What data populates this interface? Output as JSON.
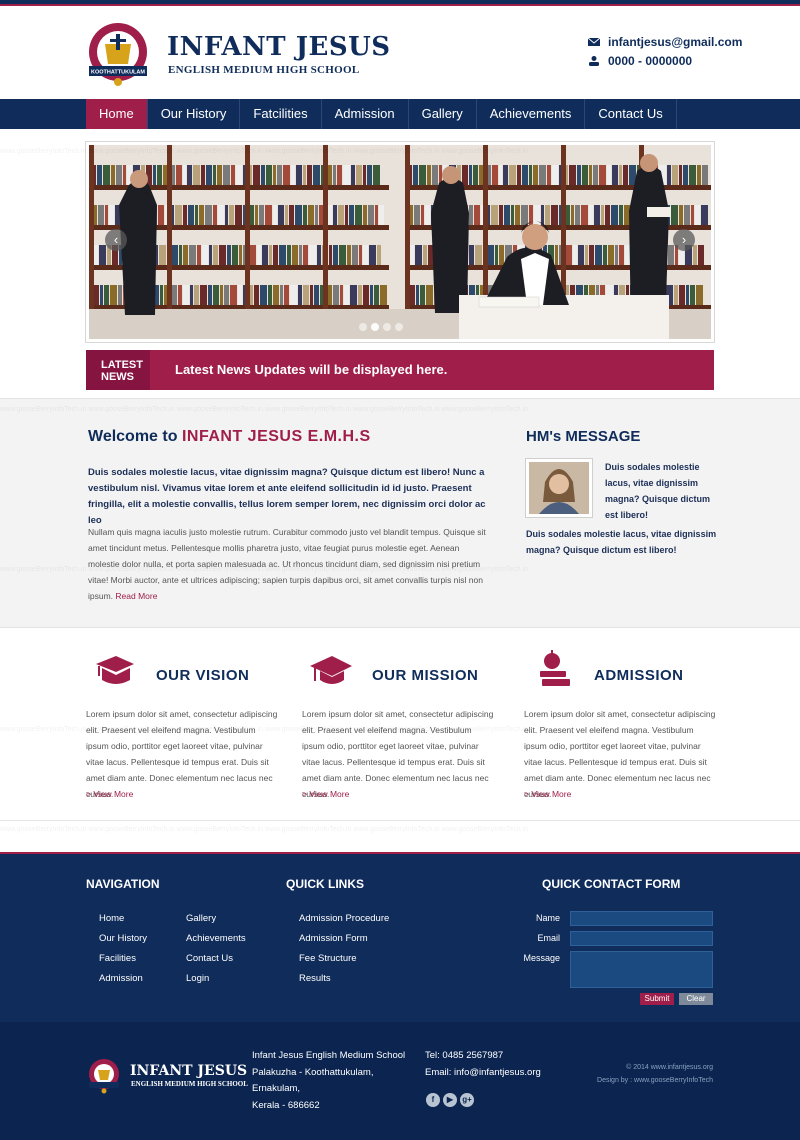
{
  "colors": {
    "navy": "#0f2c5a",
    "maroon": "#a01e4a",
    "footer": "#0c2550"
  },
  "header": {
    "title": "INFANT JESUS",
    "subtitle": "ENGLISH MEDIUM HIGH SCHOOL",
    "email": "infantjesus@gmail.com",
    "phone": "0000 - 0000000",
    "logo_text": {
      "ring": "INFANT JESUS E.M.H. SCHOOL",
      "banner": "KOOTHATTUKULAM"
    }
  },
  "nav": {
    "items": [
      "Home",
      "Our History",
      "Fatcilities",
      "Admission",
      "Gallery",
      "Achievements",
      "Contact Us"
    ],
    "active": "Home"
  },
  "slider": {
    "prev_icon": "chevron-left-icon",
    "next_icon": "chevron-right-icon",
    "slides": 4,
    "active_slide": 2
  },
  "news": {
    "tag_line1": "LATEST",
    "tag_line2": "NEWS",
    "text": "Latest News Updates will be displayed here."
  },
  "welcome": {
    "title_prefix": "Welcome to ",
    "title_highlight": "INFANT JESUS E.M.H.S",
    "lead": "Duis sodales molestie lacus, vitae dignissim magna? Quisque dictum est libero! Nunc a vestibulum nisl. Vivamus vitae lorem et ante eleifend sollicitudin id id justo. Praesent fringilla, elit a molestie convallis, tellus lorem semper lorem, nec dignissim orci dolor ac leo",
    "body": "Nullam quis magna iaculis justo molestie rutrum. Curabitur commodo justo vel blandit tempus. Quisque sit amet tincidunt metus. Pellentesque mollis pharetra justo, vitae feugiat purus molestie eget. Aenean molestie dolor nulla, et porta sapien malesuada ac. Ut rhoncus tincidunt diam, sed dignissim nisi pretium vitae! Morbi auctor, ante et ultrices adipiscing; sapien turpis dapibus orci, sit amet convallis turpis nisl non ipsum.",
    "read_more": "Read More"
  },
  "hm": {
    "title": "HM's MESSAGE",
    "text1": "Duis sodales molestie lacus, vitae dignissim magna? Quisque dictum est libero!",
    "text2": "Duis sodales molestie lacus, vitae dignissim magna? Quisque dictum est libero!"
  },
  "features": [
    {
      "title": "OUR VISION",
      "icon": "book-cap-icon",
      "body": "Lorem ipsum dolor sit amet, consectetur adipiscing elit. Praesent vel eleifend magna. Vestibulum ipsum odio, porttitor eget laoreet vitae, pulvinar vitae lacus. Pellentesque id tempus erat. Duis sit amet diam ante. Donec elementum nec lacus nec cursus.",
      "more": "> View More"
    },
    {
      "title": "OUR MISSION",
      "icon": "graduation-cap-icon",
      "body": "Lorem ipsum dolor sit amet, consectetur adipiscing elit. Praesent vel eleifend magna. Vestibulum ipsum odio, porttitor eget laoreet vitae, pulvinar vitae lacus. Pellentesque id tempus erat. Duis sit amet diam ante. Donec elementum nec lacus nec cursus.",
      "more": "> View More"
    },
    {
      "title": "ADMISSION",
      "icon": "apple-books-icon",
      "body": "Lorem ipsum dolor sit amet, consectetur adipiscing elit. Praesent vel eleifend magna. Vestibulum ipsum odio, porttitor eget laoreet vitae, pulvinar vitae lacus. Pellentesque id tempus erat. Duis sit amet diam ante. Donec elementum nec lacus nec cursus.",
      "more": "> View More"
    }
  ],
  "footer": {
    "nav_heading": "NAVIGATION",
    "nav_col1": [
      "Home",
      "Our History",
      "Facilities",
      "Admission"
    ],
    "nav_col2": [
      "Gallery",
      "Achievements",
      "Contact Us",
      "Login"
    ],
    "quick_heading": "QUICK LINKS",
    "quick_links": [
      "Admission Procedure",
      "Admission Form",
      "Fee Structure",
      "Results"
    ],
    "form_heading": "QUICK CONTACT FORM",
    "form_labels": {
      "name": "Name",
      "email": "Email",
      "message": "Message"
    },
    "submit": "Submit",
    "clear": "Clear"
  },
  "bottom": {
    "title": "INFANT JESUS",
    "subtitle": "ENGLISH MEDIUM HIGH SCHOOL",
    "address": [
      "Infant Jesus English Medium School",
      "Palakuzha - Koothattukulam,",
      "Ernakulam,",
      "Kerala - 686662"
    ],
    "tel": "Tel: 0485 2567987",
    "email": "Email: info@infantjesus.org",
    "social": [
      "f",
      "▶",
      "g+"
    ],
    "social_icons": [
      "facebook-icon",
      "youtube-icon",
      "google-plus-icon"
    ],
    "copyright": "© 2014 www.infantjesus.org",
    "credit": "Design by : www.gooseBerryInfoTech"
  },
  "watermark": "www.gooseBerryInfoTech.in"
}
